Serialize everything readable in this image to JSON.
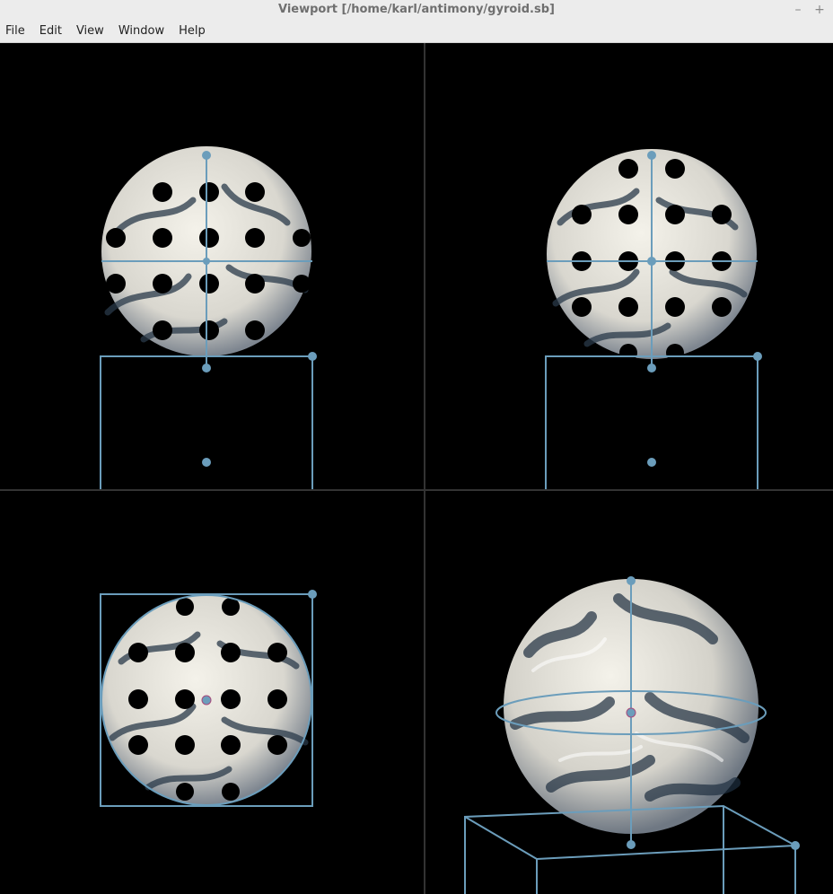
{
  "window": {
    "title": "Viewport [/home/karl/antimony/gyroid.sb]",
    "controls": [
      "–",
      "+"
    ]
  },
  "menu": {
    "items": [
      "File",
      "Edit",
      "View",
      "Window",
      "Help"
    ]
  },
  "viewports": [
    {
      "view": "front"
    },
    {
      "view": "side"
    },
    {
      "view": "top"
    },
    {
      "view": "perspective"
    }
  ],
  "colors": {
    "handle": "#6b9dbb",
    "surface_light": "#f1efe7",
    "surface_dark": "#0d1c2b",
    "background": "#000000"
  }
}
